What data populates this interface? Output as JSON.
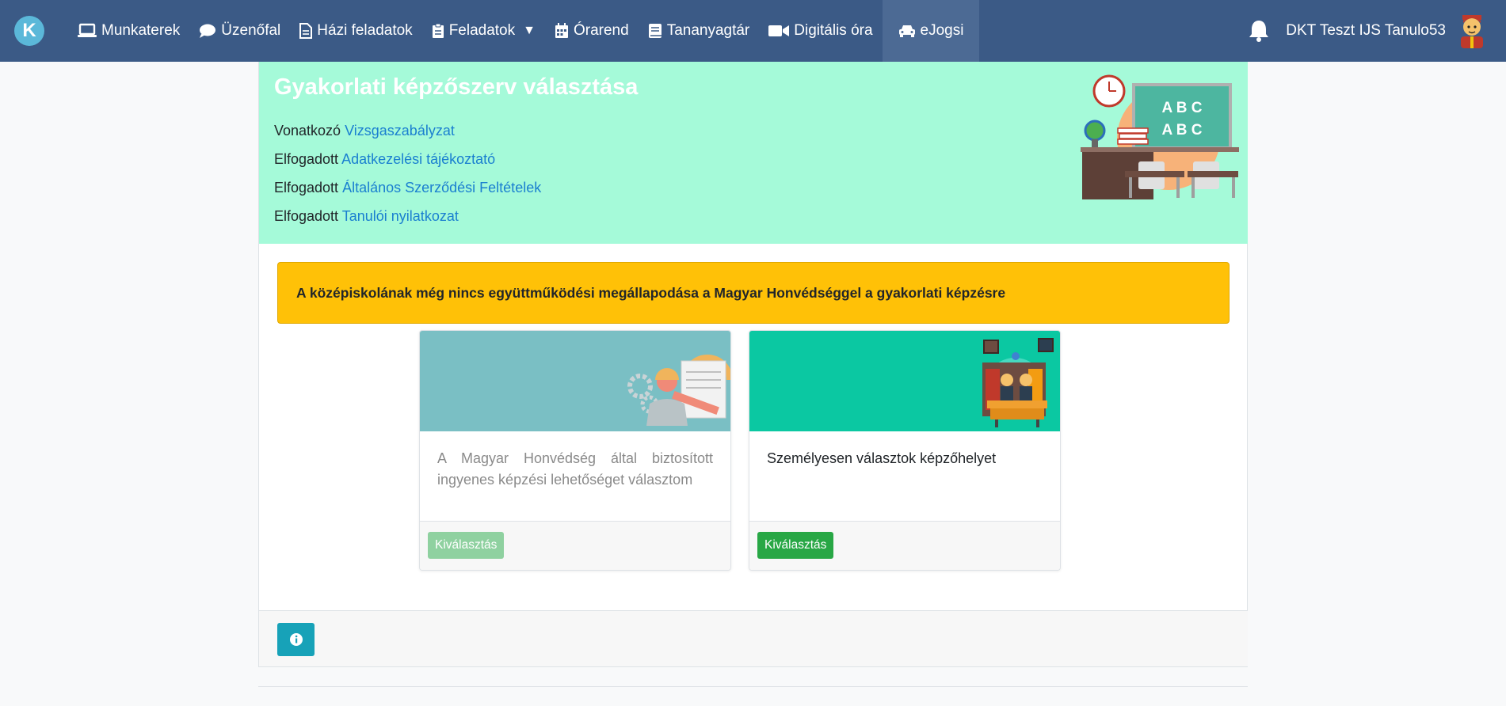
{
  "nav": {
    "logo_letter": "K",
    "items": [
      {
        "label": "Munkaterek",
        "icon": "laptop-icon"
      },
      {
        "label": "Üzenőfal",
        "icon": "comment-icon"
      },
      {
        "label": "Házi feladatok",
        "icon": "file-icon"
      },
      {
        "label": "Feladatok",
        "icon": "clipboard-icon",
        "caret": "▼"
      },
      {
        "label": "Órarend",
        "icon": "calendar-icon"
      },
      {
        "label": "Tananyagtár",
        "icon": "book-icon"
      },
      {
        "label": "Digitális óra",
        "icon": "video-icon"
      },
      {
        "label": "eJogsi",
        "icon": "car-icon",
        "active": true
      }
    ],
    "user_name": "DKT Teszt IJS Tanulo53"
  },
  "hero": {
    "title": "Gyakorlati képzőszerv választása",
    "lines": [
      {
        "prefix": "Vonatkozó",
        "link": "Vizsgaszabályzat"
      },
      {
        "prefix": "Elfogadott",
        "link": "Adatkezelési tájékoztató"
      },
      {
        "prefix": "Elfogadott",
        "link": "Általános Szerződési Feltételek"
      },
      {
        "prefix": "Elfogadott",
        "link": "Tanulói nyilatkozat"
      }
    ],
    "board_text": [
      "A B C",
      "A B C"
    ]
  },
  "alert": {
    "text": "A középiskolának még nincs együttműködési megállapodása a Magyar Honvédséggel a gyakorlati képzésre",
    "color": "#ffc107"
  },
  "cards": [
    {
      "text": "A Magyar Honvédség által biztosított ingyenes képzési lehetőséget választom",
      "button": "Kiválasztás",
      "enabled": false,
      "header_color": "#7abfc4"
    },
    {
      "text": "Személyesen választok képzőhelyet",
      "button": "Kiválasztás",
      "enabled": true,
      "header_color": "#0bc8a2"
    }
  ],
  "colors": {
    "navbar": "#3b5a86",
    "hero_bg": "#a5fad9",
    "link": "#1a7fd0",
    "success": "#28a745",
    "info": "#17a2b8"
  }
}
